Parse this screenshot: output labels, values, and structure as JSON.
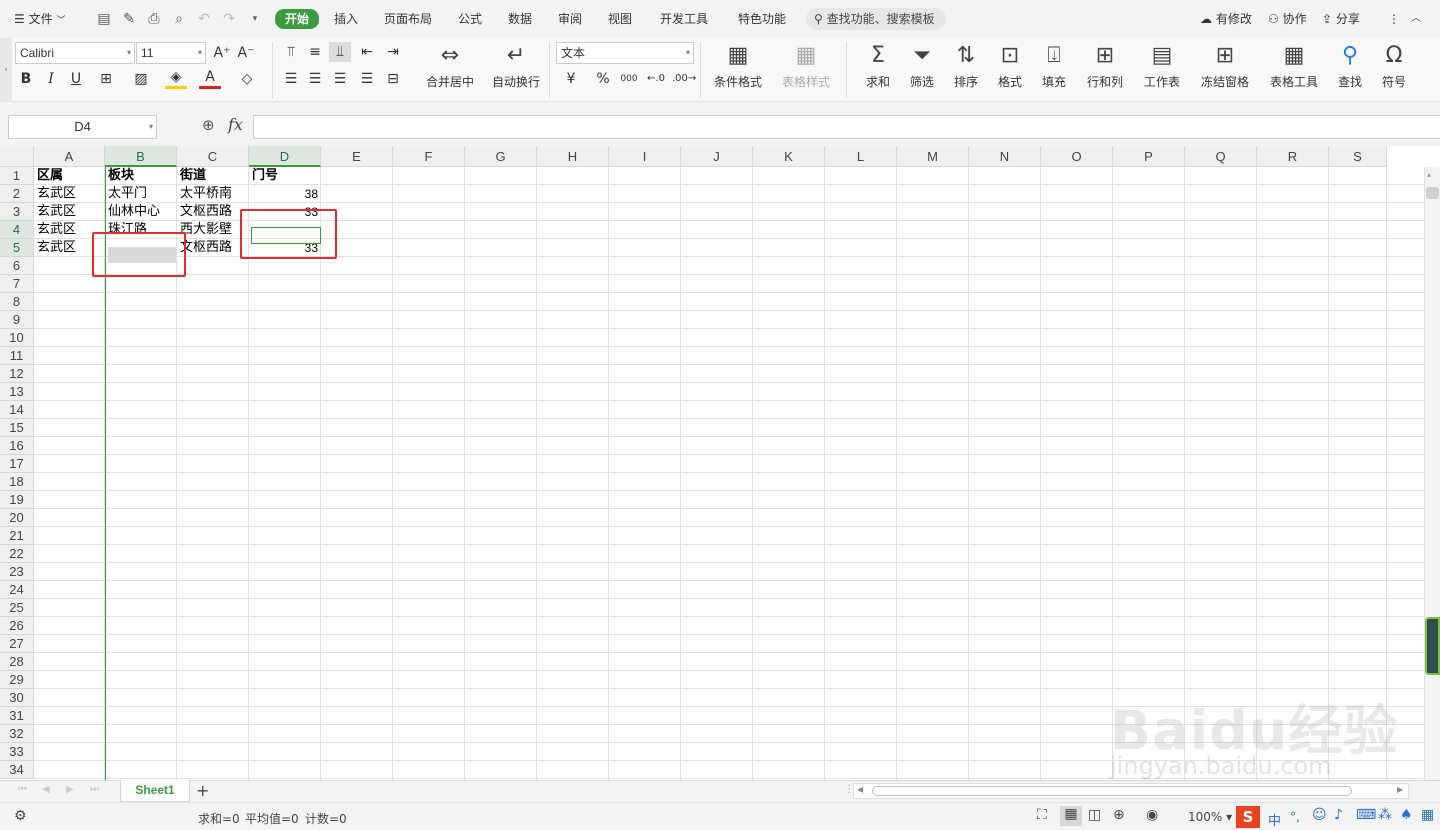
{
  "menu": {
    "file": "文件",
    "tabs": [
      "开始",
      "插入",
      "页面布局",
      "公式",
      "数据",
      "审阅",
      "视图",
      "开发工具",
      "特色功能"
    ],
    "active_tab": "开始",
    "search": "查找功能、搜索模板",
    "unsaved": "有修改",
    "collab": "协作",
    "share": "分享"
  },
  "ribbon": {
    "font_name": "Calibri",
    "font_size": "11",
    "number_format": "文本",
    "merge_center": "合并居中",
    "wrap_text": "自动换行",
    "cond_format": "条件格式",
    "table_style": "表格样式",
    "sum": "求和",
    "filter": "筛选",
    "sort": "排序",
    "format": "格式",
    "fill": "填充",
    "row_col": "行和列",
    "worksheet": "工作表",
    "freeze": "冻结窗格",
    "table_tools": "表格工具",
    "find": "查找",
    "symbol": "符号",
    "currency": "¥",
    "percent": "%",
    "thousands": "000"
  },
  "formula_bar": {
    "name_box": "D4",
    "fx": "fx",
    "content": ""
  },
  "sheet": {
    "columns": [
      "A",
      "B",
      "C",
      "D",
      "E",
      "F",
      "G",
      "H",
      "I",
      "J",
      "K",
      "L",
      "M",
      "N",
      "O",
      "P",
      "Q",
      "R",
      "S"
    ],
    "rows": [
      "1",
      "2",
      "3",
      "4",
      "5",
      "6",
      "7",
      "8",
      "9",
      "10",
      "11",
      "12",
      "13",
      "14",
      "15",
      "16",
      "17",
      "18",
      "19",
      "20",
      "21",
      "22",
      "23",
      "24",
      "25",
      "26",
      "27",
      "28",
      "29",
      "30",
      "31",
      "32",
      "33",
      "34"
    ],
    "cells": {
      "A1": "区属",
      "B1": "板块",
      "C1": "街道",
      "D1": "门号",
      "A2": "玄武区",
      "B2": "太平门",
      "C2": "太平桥南",
      "D2": "38",
      "A3": "玄武区",
      "B3": "仙林中心",
      "C3": "文枢西路",
      "D3": "33",
      "A4": "玄武区",
      "B4": "珠江路",
      "C4": "西大影壁",
      "D4": "",
      "A5": "玄武区",
      "B5": "",
      "C5": "文枢西路",
      "D5": "33"
    }
  },
  "tabs_bar": {
    "sheet_name": "Sheet1",
    "add": "+"
  },
  "status": {
    "sum": "求和=0",
    "avg": "平均值=0",
    "count": "计数=0",
    "zoom": "100%"
  },
  "colors": {
    "accent": "#3a9b3f",
    "highlight_box": "#e52b2b"
  },
  "watermark": "Baidu经验 jingyan.baidu.com"
}
